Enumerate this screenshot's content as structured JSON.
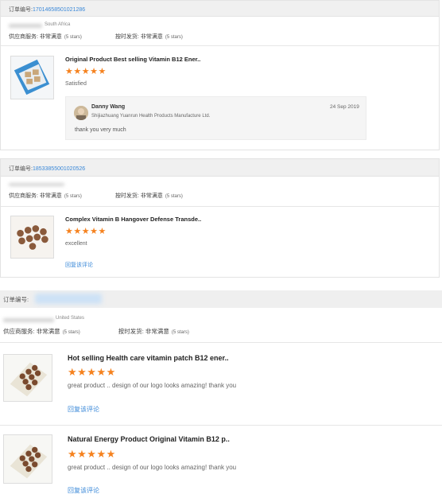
{
  "labels": {
    "order_no": "订单编号:",
    "supplier_service": "供应商服务:",
    "very_satisfied": "非常满意",
    "five_stars": "(5 stars)",
    "on_time_delivery": "按时发货:",
    "reply_link": "回复该评论"
  },
  "orders": [
    {
      "order_id": "17014658501021286",
      "country": "South Africa",
      "product": {
        "title": "Original Product Best selling Vitamin B12 Ener..",
        "stars": "★★★★★",
        "rating": 5,
        "comment": "Satisfied"
      },
      "reply": {
        "name": "Danny Wang",
        "company": "Shijiazhuang Yuanrun Health Products Manufacture Ltd.",
        "date": "24 Sep 2019",
        "text": "thank you very much"
      }
    },
    {
      "order_id": "18533855001020526",
      "country": "Mexico",
      "product": {
        "title": "Complex Vitamin B Hangover Defense Transde..",
        "stars": "★★★★★",
        "rating": 5,
        "comment": "excellent"
      }
    },
    {
      "order_id": "",
      "country": "United States",
      "products": [
        {
          "title": "Hot selling Health care vitamin patch B12 ener..",
          "stars": "★★★★★",
          "rating": 5,
          "comment": "great product .. design of our logo looks amazing!   thank you"
        },
        {
          "title": "Natural Energy Product Original Vitamin B12 p..",
          "stars": "★★★★★",
          "rating": 5,
          "comment": "great product .. design of our logo looks amazing!   thank you"
        }
      ]
    }
  ],
  "colors": {
    "link": "#3a88d8",
    "star": "#f5821f",
    "header_bg": "#f0f0f0"
  }
}
